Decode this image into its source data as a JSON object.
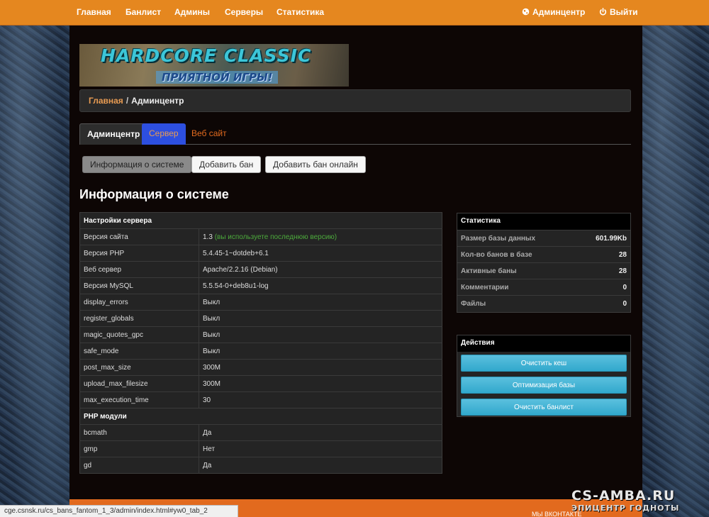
{
  "nav": {
    "items": [
      "Главная",
      "Банлист",
      "Админы",
      "Серверы",
      "Статистика"
    ],
    "admincenter": "Админцентр",
    "logout": "Выйти"
  },
  "banner": {
    "title": "HARDCORE CLASSIC",
    "subtitle": "ПРИЯТНОЙ ИГРЫ!"
  },
  "breadcrumb": {
    "home": "Главная",
    "separator": "/",
    "current": "Админцентр"
  },
  "tabs": [
    "Админцентр",
    "Сервер",
    "Веб сайт"
  ],
  "buttons": {
    "sysinfo": "Информация о системе",
    "add_ban": "Добавить бан",
    "add_ban_online": "Добавить бан онлайн"
  },
  "page_title": "Информация о системе",
  "server_settings": {
    "heading": "Настройки сервера",
    "rows": [
      {
        "k": "Версия сайта",
        "v": "1.3",
        "note": "(вы используете последнюю версию)"
      },
      {
        "k": "Версия PHP",
        "v": "5.4.45-1~dotdeb+6.1"
      },
      {
        "k": "Веб сервер",
        "v": "Apache/2.2.16 (Debian)"
      },
      {
        "k": "Версия MySQL",
        "v": "5.5.54-0+deb8u1-log"
      },
      {
        "k": "display_errors",
        "v": "Выкл"
      },
      {
        "k": "register_globals",
        "v": "Выкл"
      },
      {
        "k": "magic_quotes_gpc",
        "v": "Выкл"
      },
      {
        "k": "safe_mode",
        "v": "Выкл"
      },
      {
        "k": "post_max_size",
        "v": "300M"
      },
      {
        "k": "upload_max_filesize",
        "v": "300M"
      },
      {
        "k": "max_execution_time",
        "v": "30"
      }
    ]
  },
  "php_modules": {
    "heading": "PHP модули",
    "rows": [
      {
        "k": "bcmath",
        "v": "Да"
      },
      {
        "k": "gmp",
        "v": "Нет"
      },
      {
        "k": "gd",
        "v": "Да"
      }
    ]
  },
  "stats": {
    "heading": "Статистика",
    "rows": [
      {
        "k": "Размер базы данных",
        "v": "601.99Kb"
      },
      {
        "k": "Кол-во банов в базе",
        "v": "28"
      },
      {
        "k": "Активные баны",
        "v": "28"
      },
      {
        "k": "Комментарии",
        "v": "0"
      },
      {
        "k": "Файлы",
        "v": "0"
      }
    ]
  },
  "actions": {
    "heading": "Действия",
    "buttons": [
      "Очистить кеш",
      "Оптимизация базы",
      "Очистить банлист"
    ]
  },
  "footer": {
    "vk": "МЫ ВКОНТАКТЕ"
  },
  "status_url": "cge.csnsk.ru/cs_bans_fantom_1_3/admin/index.html#yw0_tab_2",
  "watermark": {
    "line1": "CS-AMBA.RU",
    "line2": "ЭПИЦЕНТР ГОДНОТЫ"
  },
  "colors": {
    "topbar": "#e5871f",
    "accent_link": "#e89b52",
    "tab_blue": "#2d4fe0",
    "action_button": "#5bc0de",
    "note_green": "#4caa3c"
  }
}
